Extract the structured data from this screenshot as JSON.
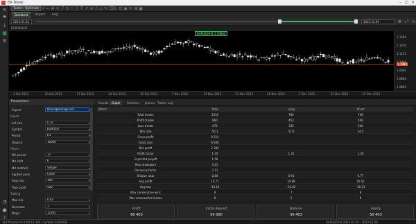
{
  "window": {
    "title": "EA Tester"
  },
  "toolbar": {
    "btn1": "Tester",
    "btn2": "Optimize"
  },
  "tabs": [
    "Backtest",
    "Report",
    "Log"
  ],
  "timebar": {
    "start": "2023.01.02",
    "end": "2023.12.29"
  },
  "chart_info": {
    "symbol": "EURUSD,H1",
    "badge": "EURUSD H1 1.10842"
  },
  "chart_data": {
    "type": "line",
    "price_ticks": [
      "1.1280",
      "1.1200",
      "1.1120",
      "1.1040",
      "1.0960",
      "1.0880",
      "1.0800"
    ],
    "current_price": "1.1084",
    "time_ticks": [
      "3 Oct 2023",
      "10 Oct 2023",
      "17 Oct 2023",
      "24 Oct 2023",
      "31 Oct 2023",
      "7 Nov 2023",
      "14 Nov 2023",
      "21 Nov 2023",
      "28 Nov 2023",
      "5 Dec 2023",
      "12 Dec 2023",
      "19 Dec 2023"
    ]
  },
  "params": {
    "header": "Parameters",
    "rows": [
      {
        "label": "Expert",
        "value": "MovingAverage.ex5",
        "sec": false,
        "hi": true
      },
      {
        "label": "Inputs",
        "value": "",
        "sec": true
      },
      {
        "label": "Lot size",
        "value": "0.10",
        "sec": false
      },
      {
        "label": "Symbol",
        "value": "EURUSD",
        "sec": false
      },
      {
        "label": "Period",
        "value": "H1",
        "sec": false
      },
      {
        "label": "Deposit",
        "value": "10000",
        "sec": false
      },
      {
        "label": "Filters",
        "value": "",
        "sec": true
      },
      {
        "label": "MA period",
        "value": "12",
        "sec": false
      },
      {
        "label": "MA shift",
        "value": "6",
        "sec": false
      },
      {
        "label": "MA method",
        "value": "Simple",
        "sec": false
      },
      {
        "label": "Applied price",
        "value": "Close",
        "sec": false
      },
      {
        "label": "Stop loss",
        "value": "300",
        "sec": false
      },
      {
        "label": "Take profit",
        "value": "500",
        "sec": false
      },
      {
        "label": "Trailing",
        "value": "",
        "sec": true
      },
      {
        "label": "Max risk",
        "value": "0.02",
        "sec": false
      },
      {
        "label": "Decrease",
        "value": "3",
        "sec": false
      },
      {
        "label": "Magic",
        "value": "12345",
        "sec": false
      }
    ]
  },
  "results_tabs": [
    "Results",
    "Graph",
    "Statistics",
    "Journal",
    "Trades",
    "Log"
  ],
  "table": {
    "headers": [
      "Metric",
      "Total",
      "Long",
      "Short"
    ],
    "rows": [
      [
        "Total trades",
        "1532",
        "784",
        "748"
      ],
      [
        "Profit trades",
        "860",
        "452",
        "408"
      ],
      [
        "Loss trades",
        "672",
        "332",
        "340"
      ],
      [
        "Win rate",
        "56.1",
        "57.6",
        "54.5"
      ],
      [
        "Gross profit",
        "9 214",
        "",
        ""
      ],
      [
        "Gross loss",
        "6 830",
        "",
        ""
      ],
      [
        "Net profit",
        "2 384",
        "",
        ""
      ],
      [
        "Profit factor",
        "1.35",
        "1.41",
        "1.29"
      ],
      [
        "Expected payoff",
        "1.56",
        "",
        ""
      ],
      [
        "Max drawdown",
        "4.21",
        "",
        ""
      ],
      [
        "Recovery factor",
        "2.11",
        "",
        ""
      ],
      [
        "Sharpe ratio",
        "0.84",
        "0.91",
        "0.77"
      ],
      [
        "Avg profit",
        "10.71",
        "10.88",
        "10.52"
      ],
      [
        "Avg loss",
        "-10.16",
        "-10.02",
        "-10.31"
      ],
      [
        "Max consecutive wins",
        "9",
        "7",
        "8"
      ],
      [
        "Max consecutive losses",
        "6",
        "5",
        "6"
      ]
    ]
  },
  "summary": [
    {
      "label": "Profit",
      "value": "60 403"
    },
    {
      "label": "Initial deposit",
      "value": "50 000"
    },
    {
      "label": "Balance",
      "value": "50 403"
    },
    {
      "label": "Equity",
      "value": "50 403"
    }
  ],
  "status": {
    "left": "Test finished in 0:00:12.345 / Symbol: EURUSD",
    "right": "EURUSD H1 2023.01.02 - 2023.12.29"
  }
}
